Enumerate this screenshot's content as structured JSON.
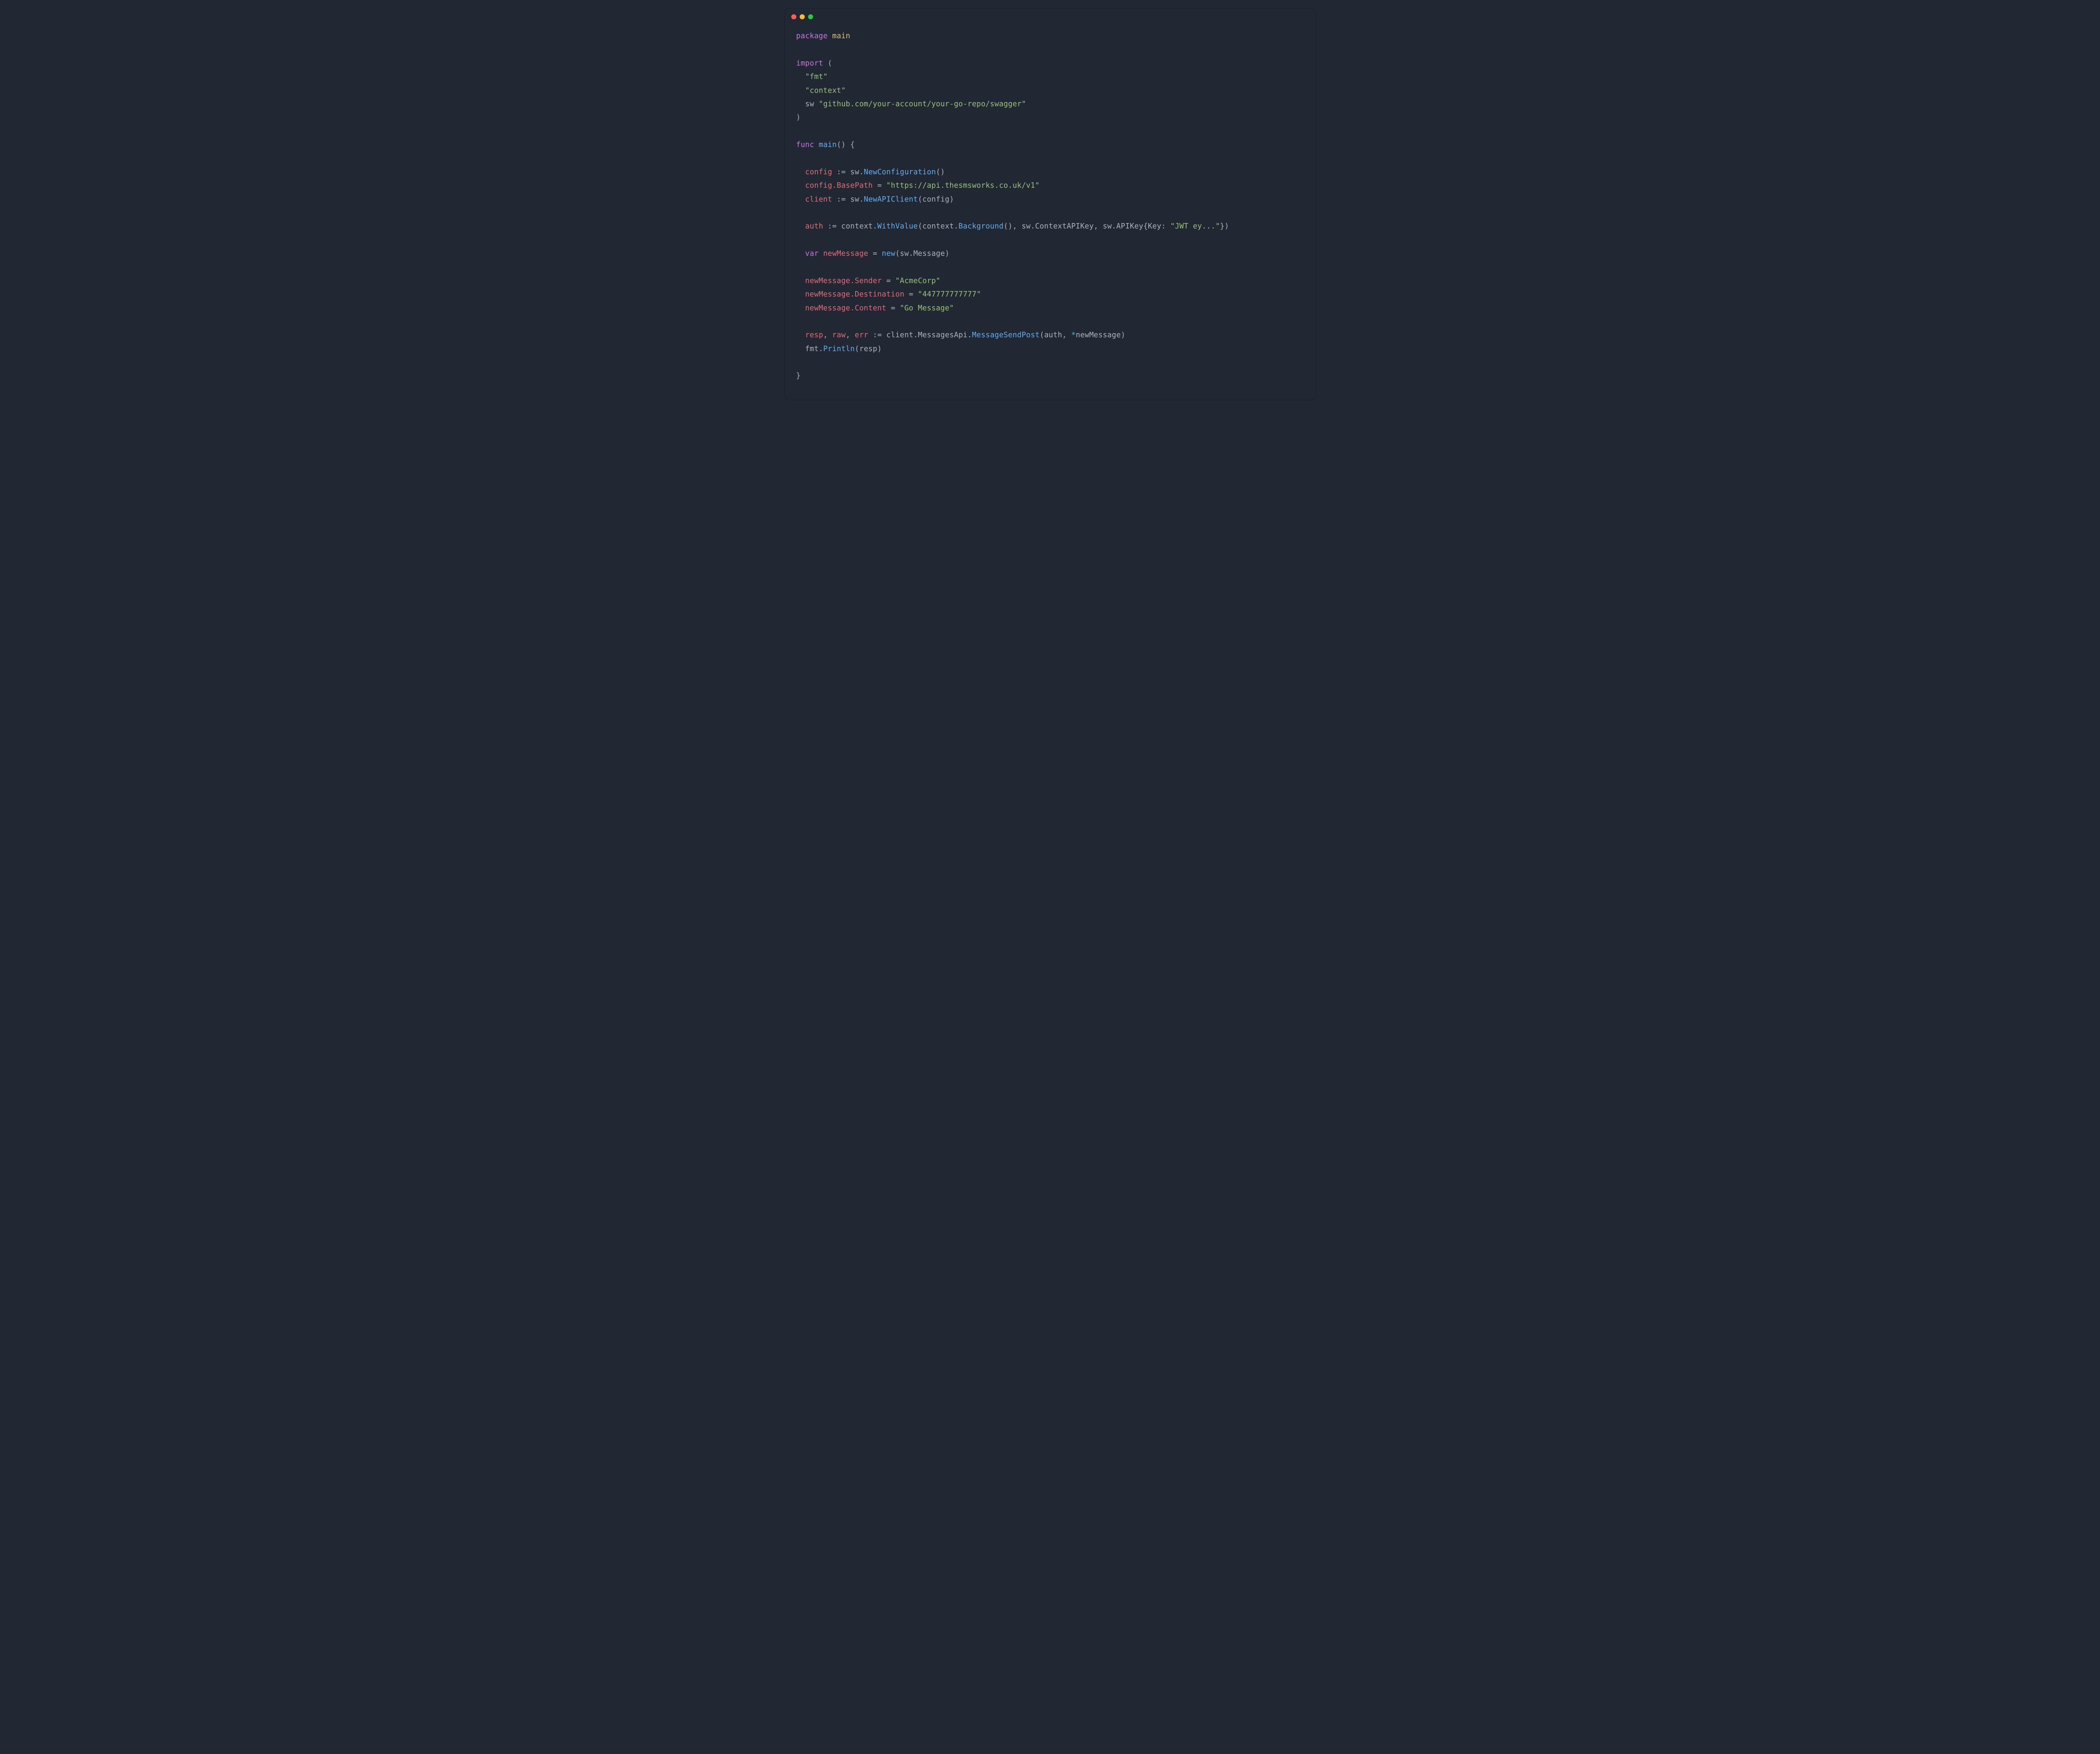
{
  "colors": {
    "background": "#222734",
    "keyword": "#c678dd",
    "identifier": "#d9c077",
    "string": "#98c379",
    "red": "#e06c75",
    "blue": "#61afef",
    "operator": "#56b6c2",
    "default": "#abb2bf"
  },
  "titlebar": {
    "dots": [
      "red",
      "yellow",
      "green"
    ]
  },
  "code": {
    "l1_kw_package": "package",
    "l1_ident": "main",
    "l3_kw_import": "import",
    "l3_paren": " (",
    "l4_str_fmt": "\"fmt\"",
    "l5_str_ctx": "\"context\"",
    "l6_sw": "sw ",
    "l6_str": "\"github.com/your-account/your-go-repo/swagger\"",
    "l7_paren": ")",
    "l9_kw_func": "func",
    "l9_main": "main",
    "l9_rest": "() {",
    "l11_config": "config",
    "l11_assign": " := ",
    "l11_sw": "sw.",
    "l11_newconf": "NewConfiguration",
    "l11_parens": "()",
    "l12_cfgbase": "config.BasePath",
    "l12_eq": " = ",
    "l12_str": "\"https://api.thesmsworks.co.uk/v1\"",
    "l13_client": "client",
    "l13_assign": " := ",
    "l13_sw": "sw.",
    "l13_newapi": "NewAPIClient",
    "l13_arg": "(config)",
    "l15_auth": "auth",
    "l15_assign": " := ",
    "l15_ctx1": "context.",
    "l15_withvalue": "WithValue",
    "l15_open": "(context.",
    "l15_bg": "Background",
    "l15_mid": "(), sw.ContextAPIKey, sw.APIKey{Key: ",
    "l15_str": "\"JWT ey...\"",
    "l15_close": "})",
    "l17_var": "var",
    "l17_newmsg": " newMessage",
    "l17_eq": " = ",
    "l17_new": "new",
    "l17_arg": "(sw.Message)",
    "l19_sender_lhs": "newMessage.Sender",
    "l19_eq": " = ",
    "l19_str": "\"AcmeCorp\"",
    "l20_dest_lhs": "newMessage.Destination",
    "l20_eq": " = ",
    "l20_str": "\"447777777777\"",
    "l21_content_lhs": "newMessage.Content",
    "l21_eq": " = ",
    "l21_str": "\"Go Message\"",
    "l23_resp": "resp",
    "l23_c1": ", ",
    "l23_raw": "raw",
    "l23_c2": ", ",
    "l23_err": "err",
    "l23_assign": " := ",
    "l23_client": "client.MessagesApi.",
    "l23_msp": "MessageSendPost",
    "l23_open": "(auth, ",
    "l23_star": "*",
    "l23_nm": "newMessage)",
    "l24_fmt": "fmt.",
    "l24_println": "Println",
    "l24_arg": "(resp)",
    "l26_close": "}"
  }
}
